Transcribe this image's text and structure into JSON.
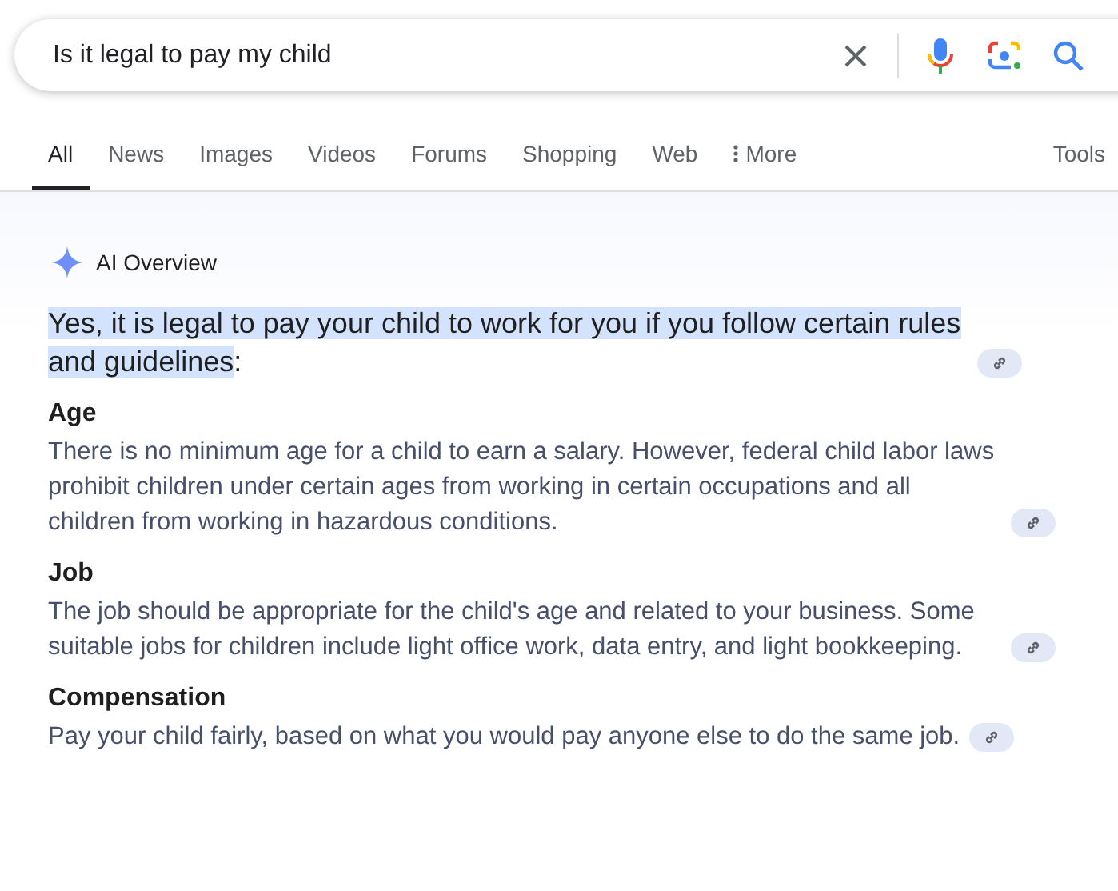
{
  "search": {
    "value": "Is it legal to pay my child"
  },
  "tabs": [
    {
      "label": "All",
      "selected": true
    },
    {
      "label": "News",
      "selected": false
    },
    {
      "label": "Images",
      "selected": false
    },
    {
      "label": "Videos",
      "selected": false
    },
    {
      "label": "Forums",
      "selected": false
    },
    {
      "label": "Shopping",
      "selected": false
    },
    {
      "label": "Web",
      "selected": false
    },
    {
      "label": "More",
      "selected": false,
      "kind": "menu"
    }
  ],
  "tools": "Tools",
  "overview": {
    "title": "AI Overview",
    "headline": {
      "highlighted": "Yes, it is legal to pay your child to work for you if you follow certain rules and guidelines",
      "rest": ":"
    },
    "sections": [
      {
        "heading": "Age",
        "body": "There is no minimum age for a child to earn a salary. However, federal child labor laws prohibit children under certain ages from working in certain occupations and all children from working in hazardous conditions."
      },
      {
        "heading": "Job",
        "body": "The job should be appropriate for the child's age and related to your business. Some suitable jobs for children include light office work, data entry, and light bookkeeping."
      },
      {
        "heading": "Compensation",
        "body": "Pay your child fairly, based on what you would pay anyone else to do the same job."
      }
    ]
  }
}
